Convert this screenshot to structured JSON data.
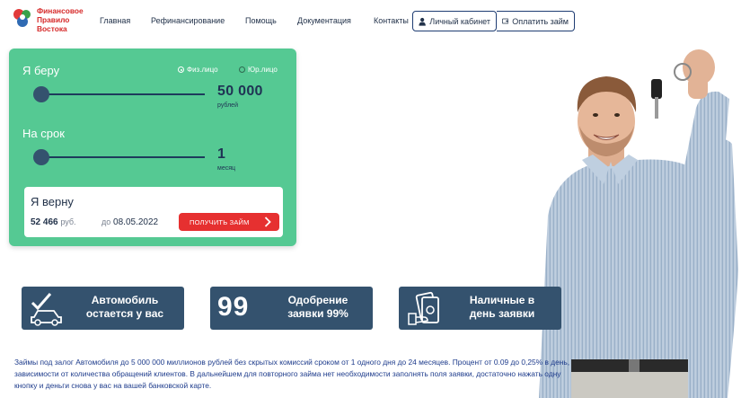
{
  "brand": {
    "logo_lines": [
      "Финансовое",
      "Правило",
      "Востока"
    ],
    "color": "#d62a2a"
  },
  "nav": {
    "items": [
      "Главная",
      "Рефинансирование",
      "Помощь",
      "Документация",
      "Контакты"
    ],
    "cabinet": "Личный кабинет",
    "pay": "Оплатить займ",
    "cabinet_icon": "user-icon",
    "pay_icon": "wallet-icon"
  },
  "calculator": {
    "amount_label": "Я беру",
    "person_options": [
      "Физ.лицо",
      "Юр.лицо"
    ],
    "person_selected": "Физ.лицо",
    "amount_value": "50 000",
    "amount_unit": "рублей",
    "term_label": "На срок",
    "term_value": "1",
    "term_unit": "месяц",
    "return_label": "Я верну",
    "return_amount": "52 466",
    "return_currency": "руб.",
    "return_date_prefix": "до",
    "return_date": "08.05.2022",
    "cta": "ПОЛУЧИТЬ ЗАЙМ",
    "background": "#55c993"
  },
  "features": [
    {
      "icon": "car-check-icon",
      "text": [
        "Автомобиль",
        "остается у вас"
      ]
    },
    {
      "big": "99",
      "text": [
        "Одобрение",
        "заявки 99%"
      ]
    },
    {
      "icon": "cash-icon",
      "text": [
        "Наличные в",
        "день заявки"
      ]
    }
  ],
  "description": "Займы под залог Автомобиля до 5 000 000 миллионов рублей без скрытых комиссий сроком от 1 одного дня до 24 месяцев. Процент от 0.09 до 0,25% в день, зависимости от количества обращений клиентов. В дальнейшем для повторного займа нет необходимости заполнять поля заявки, достаточно нажать одну кнопку и деньги снова у вас на вашей банковской карте.",
  "colors": {
    "accent_green": "#55c993",
    "navy": "#34526e",
    "cta_red": "#e63030",
    "text_blue": "#1e3c8c"
  }
}
